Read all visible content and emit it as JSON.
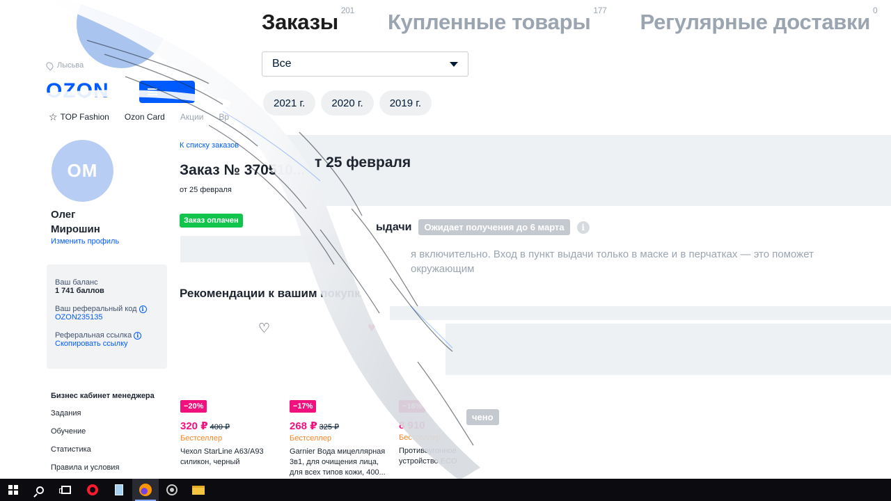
{
  "orders_page": {
    "tabs": [
      {
        "label": "Заказы",
        "count": "201"
      },
      {
        "label": "Купленные товары",
        "count": "177"
      },
      {
        "label": "Регулярные доставки",
        "count": "0"
      }
    ],
    "filter": {
      "value": "Все"
    },
    "years": [
      "2021 г.",
      "2020 г.",
      "2019 г."
    ],
    "order_head": "т 25 февраля",
    "status_label": "ыдачи",
    "status_badge": "Ожидает получения до 6 марта",
    "notice": "я включительно. Вход в пункт выдачи только в маске и в перчатках — это поможет окружающим",
    "done_badge": "чено"
  },
  "header": {
    "location": "Лысьва",
    "logo": "OZON",
    "nav": {
      "top_fashion": "TOP Fashion",
      "ozon_card": "Ozon Card",
      "promos": "Акции",
      "fourth": "Вр"
    }
  },
  "profile": {
    "initials": "ОМ",
    "name_first": "Олег",
    "name_last": "Мирошин",
    "edit": "Изменить профиль",
    "balance_label": "Ваш баланс",
    "balance_value": "1 741 баллов",
    "ref_code_label": "Ваш реферальный код",
    "ref_code": "OZON235135",
    "ref_link_label": "Реферальная ссылка",
    "ref_link_action": "Скопировать ссылку"
  },
  "side_menu": {
    "heading": "Бизнес кабинет менеджера",
    "items": [
      "Задания",
      "Обучение",
      "Статистика",
      "Правила и условия"
    ]
  },
  "order_detail": {
    "breadcrumb": "К списку заказов",
    "title": "Заказ № 3705",
    "title_dim": "10...",
    "date": "от 25 февраля",
    "paid_badge": "Заказ оплачен",
    "recommendations_title": "Рекомендации к вашим покупкам"
  },
  "products": [
    {
      "discount": "−20%",
      "price": "320 ₽",
      "old_price": "400 ₽",
      "tag": "Бестселлер",
      "name": "Чехол StarLine A63/A93 силикон, черный"
    },
    {
      "discount": "−17%",
      "price": "268 ₽",
      "old_price": "325 ₽",
      "tag": "Бестселлер",
      "name": "Garnier Вода мицеллярная 3в1, для очищения лица, для всех типов кожи, 400..."
    },
    {
      "discount": "−18%",
      "price": "8 910",
      "old_price": "",
      "tag": "Бестселлер",
      "name": "Противоугонное устройство ECO"
    }
  ],
  "icons": {
    "heart": "heart-icon",
    "heart_filled": "heart-filled-icon",
    "info": "info-icon",
    "star": "star-icon",
    "pin": "location-pin-icon"
  },
  "colors": {
    "brand": "#005bff",
    "discount": "#f1117e",
    "bestseller": "#f9852a",
    "paid": "#10c44c"
  }
}
